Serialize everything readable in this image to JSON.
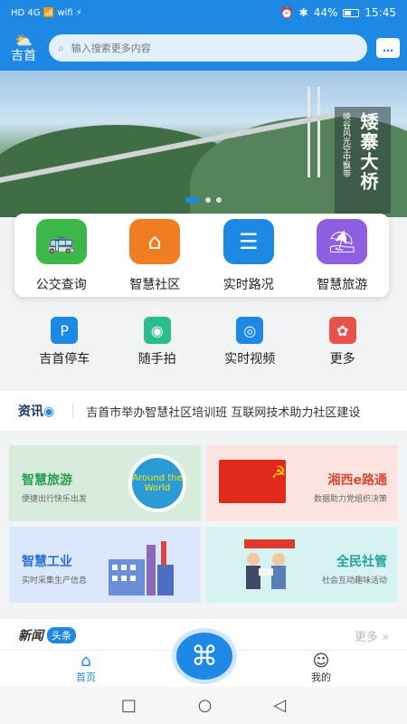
{
  "status": {
    "left_icons": "HD 4G 📶 wifi ⚡",
    "battery": "44%",
    "time": "15:45"
  },
  "top": {
    "city": "吉首",
    "weather_icon": "⛅",
    "search_placeholder": "输入搜索更多内容",
    "message_icon": "…"
  },
  "banner": {
    "title": "矮寨大桥",
    "subtitle": "峡谷风光空中飘带"
  },
  "main_services": [
    {
      "label": "公交查询",
      "icon": "bus-icon",
      "color": "#3cb84a",
      "glyph": "🚌"
    },
    {
      "label": "智慧社区",
      "icon": "home-icon",
      "color": "#f07d22",
      "glyph": "⌂"
    },
    {
      "label": "实时路况",
      "icon": "traffic-light-icon",
      "color": "#1e88e5",
      "glyph": "☰"
    },
    {
      "label": "智慧旅游",
      "icon": "umbrella-icon",
      "color": "#8e5fe0",
      "glyph": "⛱"
    }
  ],
  "sub_services": [
    {
      "label": "吉首停车",
      "icon": "parking-icon",
      "color": "#1e88e5",
      "glyph": "P"
    },
    {
      "label": "随手拍",
      "icon": "camera-icon",
      "color": "#2bbd8f",
      "glyph": "◉"
    },
    {
      "label": "实时视频",
      "icon": "video-icon",
      "color": "#1e88e5",
      "glyph": "◎"
    },
    {
      "label": "更多",
      "icon": "more-icon",
      "color": "#e8524a",
      "glyph": "✿"
    }
  ],
  "news_ticker": {
    "tag_prefix": "资讯",
    "tag_icon": "◉",
    "text": "吉首市举办智慧社区培训班 互联网技术助力社区建设"
  },
  "features": [
    {
      "title": "智慧旅游",
      "subtitle": "便捷出行快乐出发",
      "art": "Around the World"
    },
    {
      "title": "湘西e路通",
      "subtitle": "数据助力党组织决策",
      "art": "☭"
    },
    {
      "title": "智慧工业",
      "subtitle": "实时采集生产信息"
    },
    {
      "title": "全民社管",
      "subtitle": "社会互动趣味活动"
    }
  ],
  "news_header": {
    "label": "新闻",
    "badge": "头条",
    "more": "更多 »"
  },
  "tabs": {
    "home_label": "首页",
    "me_label": "我的"
  },
  "android_nav": {
    "square": "□",
    "circle": "○",
    "back": "◁"
  }
}
